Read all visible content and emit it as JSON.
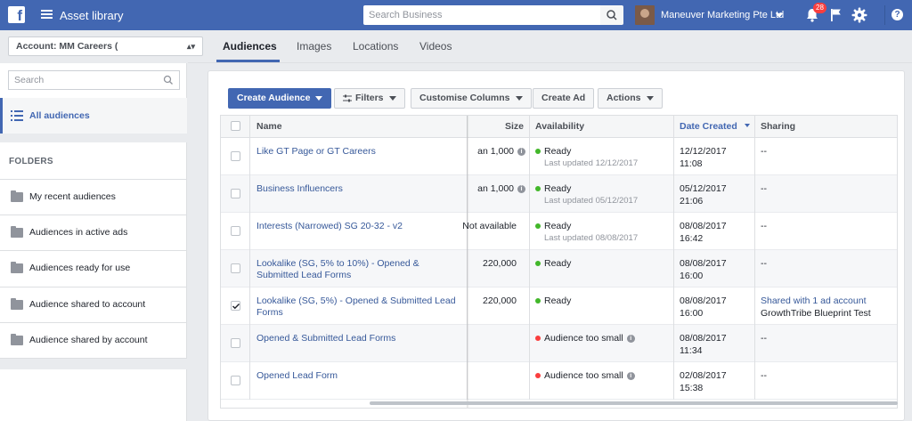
{
  "topbar": {
    "logo": "f",
    "app_title": "Asset library",
    "search_placeholder": "Search Business",
    "business_name": "Maneuver Marketing Pte Ltd",
    "notification_count": "28",
    "help": "?",
    "brand_color": "#4267b2"
  },
  "sidebar": {
    "account": "Account: MM Careers (",
    "search_placeholder": "Search",
    "all_audiences": "All audiences",
    "folders_heading": "FOLDERS",
    "folders": [
      "My recent audiences",
      "Audiences in active ads",
      "Audiences ready for use",
      "Audience shared to account",
      "Audience shared by account"
    ]
  },
  "tabs": [
    "Audiences",
    "Images",
    "Locations",
    "Videos"
  ],
  "toolbar": {
    "create": "Create Audience",
    "filters": "Filters",
    "customise": "Customise Columns",
    "create_ad": "Create Ad",
    "actions": "Actions"
  },
  "table": {
    "headers": {
      "name": "Name",
      "size": "Size",
      "availability": "Availability",
      "date": "Date Created",
      "sharing": "Sharing"
    },
    "rows": [
      {
        "name": "Like GT Page or GT Careers",
        "size": "an 1,000",
        "status": "Ready",
        "status_color": "#42b72a",
        "updated": "Last updated 12/12/2017",
        "date": "12/12/2017",
        "time": "11:08",
        "sharing": "--",
        "sharing_sub": "",
        "checked": false
      },
      {
        "name": "Business Influencers",
        "size": "an 1,000",
        "status": "Ready",
        "status_color": "#42b72a",
        "updated": "Last updated 05/12/2017",
        "date": "05/12/2017",
        "time": "21:06",
        "sharing": "--",
        "sharing_sub": "",
        "checked": false
      },
      {
        "name": "Interests (Narrowed) SG 20-32 - v2",
        "size": "Not available",
        "status": "Ready",
        "status_color": "#42b72a",
        "updated": "Last updated 08/08/2017",
        "date": "08/08/2017",
        "time": "16:42",
        "sharing": "--",
        "sharing_sub": "",
        "checked": false
      },
      {
        "name": "Lookalike (SG, 5% to 10%) - Opened & Submitted Lead Forms",
        "size": "220,000",
        "status": "Ready",
        "status_color": "#42b72a",
        "updated": "",
        "date": "08/08/2017",
        "time": "16:00",
        "sharing": "--",
        "sharing_sub": "",
        "checked": false
      },
      {
        "name": "Lookalike (SG, 5%) - Opened & Submitted Lead Forms",
        "size": "220,000",
        "status": "Ready",
        "status_color": "#42b72a",
        "updated": "",
        "date": "08/08/2017",
        "time": "16:00",
        "sharing": "Shared with 1 ad account",
        "sharing_sub": "GrowthTribe Blueprint Test",
        "checked": true
      },
      {
        "name": "Opened & Submitted Lead Forms",
        "size": "",
        "status": "Audience too small",
        "status_color": "#fa3e3e",
        "updated": "",
        "date": "08/08/2017",
        "time": "11:34",
        "sharing": "--",
        "sharing_sub": "",
        "checked": false
      },
      {
        "name": "Opened Lead Form",
        "size": "",
        "status": "Audience too small",
        "status_color": "#fa3e3e",
        "updated": "",
        "date": "02/08/2017",
        "time": "15:38",
        "sharing": "--",
        "sharing_sub": "",
        "checked": false
      }
    ]
  }
}
